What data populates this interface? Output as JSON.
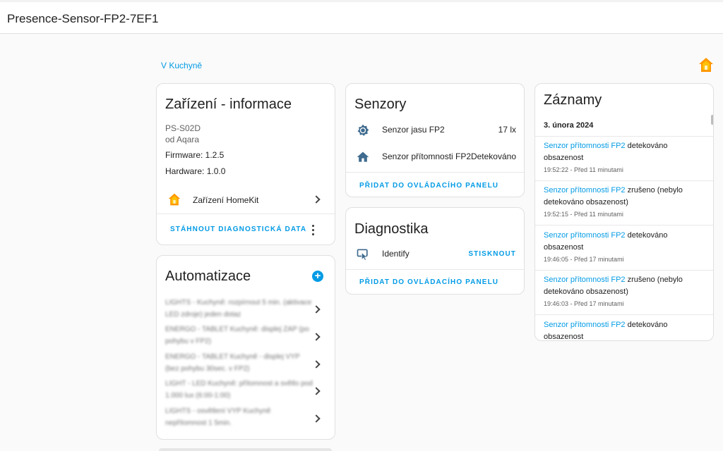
{
  "page": {
    "title": "Presence-Sensor-FP2-7EF1",
    "area_link": "V Kuchyně"
  },
  "device_info": {
    "title": "Zařízení - informace",
    "model": "PS-S02D",
    "manufacturer": "od Aqara",
    "firmware": "Firmware: 1.2.5",
    "hardware": "Hardware: 1.0.0",
    "homekit_label": "Zařízení HomeKit",
    "download_action": "STÁHNOUT DIAGNOSTICKÁ DATA"
  },
  "automations": {
    "title": "Automatizace",
    "items": [
      {
        "label": "LIGHTS - Kuchyně: rozpírnout 5 min. (aktivace LED zdroje) jeden dotaz"
      },
      {
        "label": "ENERGO - TABLET Kuchyně: displej ZAP (po pohybu v FP2)"
      },
      {
        "label": "ENERGO - TABLET Kuchyně - displej VYP (bez pohybu 30sec. v FP2)"
      },
      {
        "label": "LIGHT - LED Kuchyně: přítomnost a světlo pod 1.000 lux (6:00-1:00)"
      },
      {
        "label": "LIGHTS - osvětlení VYP Kuchyně nepřítomnost 1 5min."
      }
    ]
  },
  "sensors": {
    "title": "Senzory",
    "rows": [
      {
        "icon": "brightness-icon",
        "label": "Senzor jasu FP2",
        "value": "17 lx"
      },
      {
        "icon": "home-icon",
        "label": "Senzor přítomnosti FP2",
        "value": "Detekováno"
      }
    ],
    "add_action": "PŘIDAT DO OVLÁDACÍHO PANELU"
  },
  "diagnostics": {
    "title": "Diagnostika",
    "row": {
      "icon": "identify-icon",
      "label": "Identify",
      "action": "STISKNOUT"
    },
    "add_action": "PŘIDAT DO OVLÁDACÍHO PANELU"
  },
  "records": {
    "title": "Záznamy",
    "date": "3. února 2024",
    "entries": [
      {
        "entity": "Senzor přítomnosti FP2",
        "message": " detekováno obsazenost",
        "time": "19:52:22 - Před 11 minutami"
      },
      {
        "entity": "Senzor přítomnosti FP2",
        "message": " zrušeno (nebylo detekováno obsazenost)",
        "time": "19:52:15 - Před 11 minutami"
      },
      {
        "entity": "Senzor přítomnosti FP2",
        "message": " detekováno obsazenost",
        "time": "19:46:05 - Před 17 minutami"
      },
      {
        "entity": "Senzor přítomnosti FP2",
        "message": " zrušeno (nebylo detekováno obsazenost)",
        "time": "19:46:03 - Před 17 minutami"
      },
      {
        "entity": "Senzor přítomnosti FP2",
        "message": " detekováno obsazenost",
        "time": ""
      }
    ]
  },
  "colors": {
    "accent": "#039be5",
    "homekit_orange": "#ff9800",
    "icon_blue": "#3f6b8f"
  }
}
